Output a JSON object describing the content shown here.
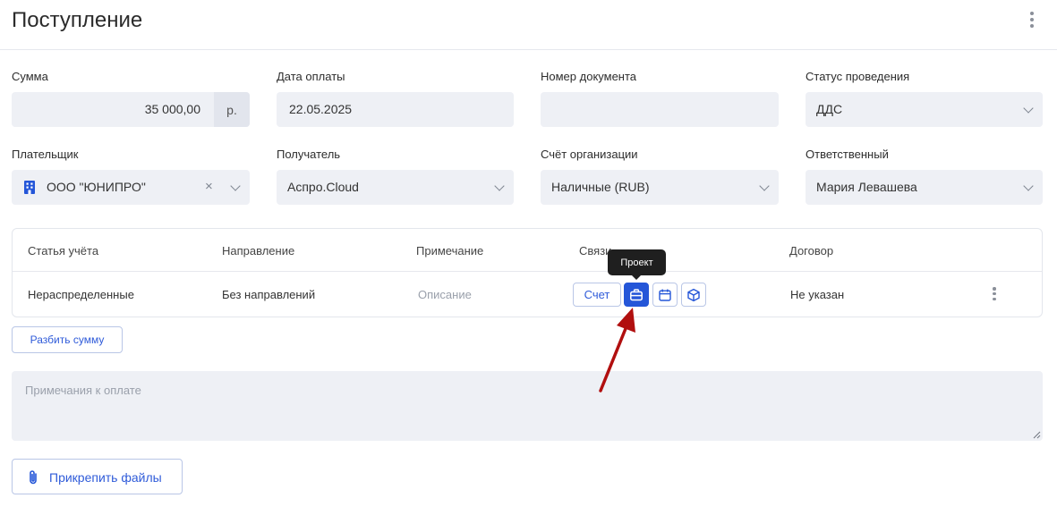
{
  "page": {
    "title": "Поступление"
  },
  "form": {
    "amount": {
      "label": "Сумма",
      "value": "35 000,00",
      "currency": "р."
    },
    "payment_date": {
      "label": "Дата оплаты",
      "value": "22.05.2025"
    },
    "doc_number": {
      "label": "Номер документа",
      "value": ""
    },
    "status": {
      "label": "Статус проведения",
      "value": "ДДС"
    },
    "payer": {
      "label": "Плательщик",
      "value": "ООО \"ЮНИПРО\"",
      "clear_symbol": "×"
    },
    "recipient": {
      "label": "Получатель",
      "value": "Аспро.Cloud"
    },
    "account": {
      "label": "Счёт организации",
      "value": "Наличные (RUB)"
    },
    "responsible": {
      "label": "Ответственный",
      "value": "Мария Левашева"
    }
  },
  "table": {
    "headers": [
      "Статья учёта",
      "Направление",
      "Примечание",
      "Связи",
      "Договор"
    ],
    "row": {
      "article": "Нераспределенные",
      "direction": "Без направлений",
      "note_placeholder": "Описание",
      "link_invoice": "Счет",
      "contract": "Не указан"
    }
  },
  "tooltip": {
    "text": "Проект"
  },
  "split_button": "Разбить сумму",
  "notes": {
    "placeholder": "Примечания к оплате"
  },
  "attach_button": "Прикрепить файлы",
  "icons": {
    "header_menu": "kebab-vertical-icon",
    "payer": "building-icon",
    "project": "briefcase-icon",
    "calendar": "calendar-icon",
    "product": "cube-icon",
    "attach": "paperclip-icon",
    "row_menu": "kebab-vertical-icon"
  },
  "colors": {
    "accent": "#2456d8",
    "field_bg": "#eef0f5",
    "tooltip_bg": "#1f1f1f",
    "arrow": "#b10f0f"
  }
}
